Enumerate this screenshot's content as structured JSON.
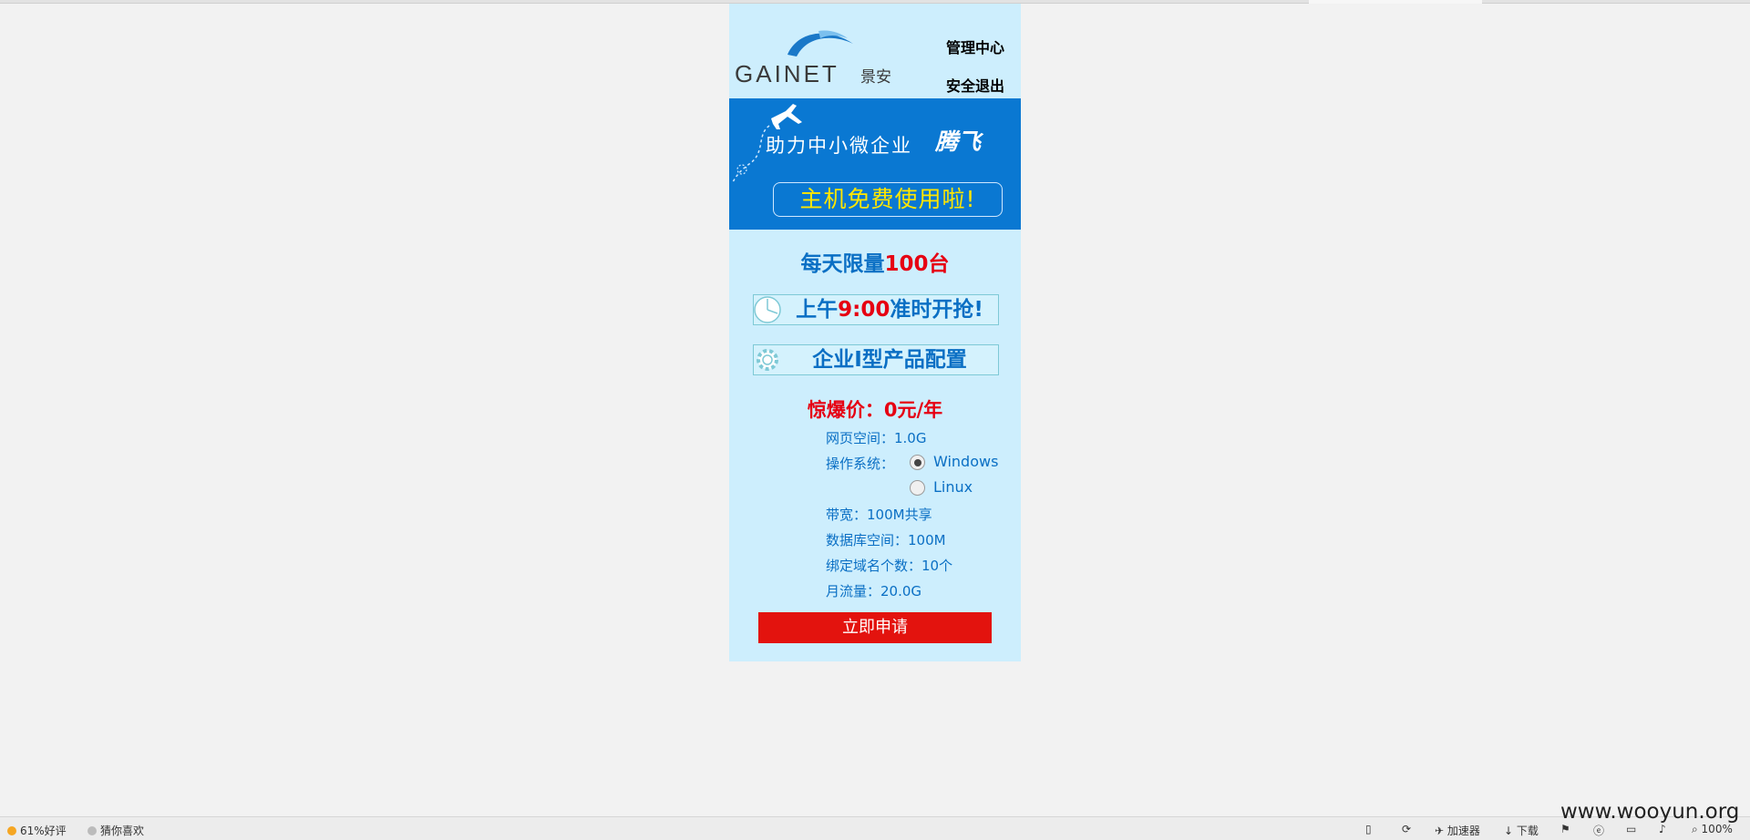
{
  "header": {
    "logo_text": "GAINET",
    "logo_cn": "景安",
    "links": [
      "管理中心",
      "安全退出"
    ]
  },
  "banner": {
    "slogan": "助力中小微企业",
    "slogan_em": "腾飞",
    "bubble": "主机免费使用啦!"
  },
  "promo": {
    "limit_prefix": "每天限量",
    "limit_count": "100台",
    "time_prefix": "上午",
    "time": "9:00",
    "time_suffix": "准时开抢!",
    "product": "企业I型产品配置",
    "price": "惊爆价：0元/年"
  },
  "specs": {
    "web_space": "网页空间：1.0G",
    "os_label": "操作系统：",
    "os_options": [
      "Windows",
      "Linux"
    ],
    "os_selected": "Windows",
    "bandwidth": "带宽：100M共享",
    "db_space": "数据库空间：100M",
    "domains": "绑定域名个数：10个",
    "traffic": "月流量：20.0G"
  },
  "apply_label": "立即申请",
  "statusbar": {
    "rating": "61%好评",
    "recommend": "猜你喜欢",
    "accelerator": "加速器",
    "download": "下载",
    "zoom": "100%"
  },
  "watermark": "www.wooyun.org",
  "colors": {
    "panel_bg": "#cdeefd",
    "banner_bg": "#0a78d2",
    "accent_blue": "#0a6fc4",
    "accent_red": "#e60012",
    "button_red": "#e3130e",
    "bubble_text": "#ffe600"
  }
}
